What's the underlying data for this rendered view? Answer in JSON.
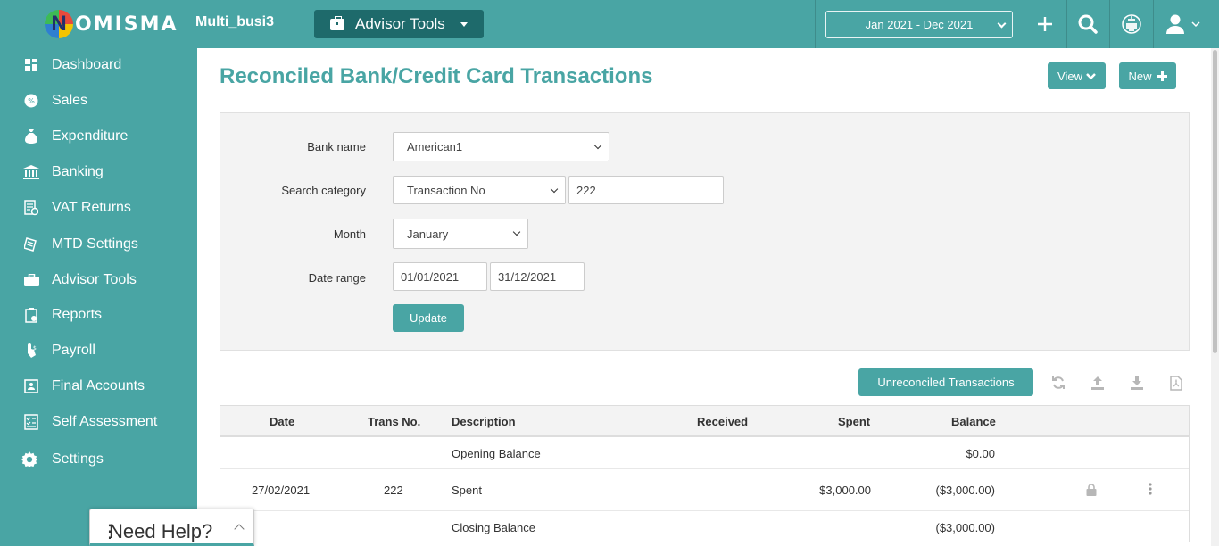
{
  "app": {
    "logo_letter": "N",
    "logo_text": "OMISMA",
    "company": "Multi_busi3",
    "advisor_tools_label": "Advisor Tools",
    "period": "Jan 2021 - Dec 2021"
  },
  "sidebar": {
    "items": [
      {
        "label": "Dashboard",
        "icon": "dashboard-icon"
      },
      {
        "label": "Sales",
        "icon": "sales-icon"
      },
      {
        "label": "Expenditure",
        "icon": "money-bag-icon"
      },
      {
        "label": "Banking",
        "icon": "bank-icon"
      },
      {
        "label": "VAT Returns",
        "icon": "vat-icon"
      },
      {
        "label": "MTD Settings",
        "icon": "mtd-icon"
      },
      {
        "label": "Advisor Tools",
        "icon": "briefcase-icon"
      },
      {
        "label": "Reports",
        "icon": "reports-icon"
      },
      {
        "label": "Payroll",
        "icon": "payroll-icon"
      },
      {
        "label": "Final Accounts",
        "icon": "final-accounts-icon"
      },
      {
        "label": "Self Assessment",
        "icon": "self-assessment-icon"
      },
      {
        "label": "Settings",
        "icon": "gear-icon"
      }
    ]
  },
  "page": {
    "title": "Reconciled Bank/Credit Card Transactions",
    "view_label": "View",
    "new_label": "New"
  },
  "filters": {
    "bank_name_label": "Bank name",
    "bank_name_value": "American1",
    "search_category_label": "Search category",
    "search_category_value": "Transaction No",
    "search_value": "222",
    "month_label": "Month",
    "month_value": "January",
    "date_range_label": "Date range",
    "date_from": "01/01/2021",
    "date_to": "31/12/2021",
    "update_label": "Update"
  },
  "toolbar": {
    "unreconciled_label": "Unreconciled Transactions"
  },
  "table": {
    "headers": {
      "date": "Date",
      "trans_no": "Trans No.",
      "description": "Description",
      "received": "Received",
      "spent": "Spent",
      "balance": "Balance"
    },
    "opening": {
      "description": "Opening Balance",
      "balance": "$0.00"
    },
    "rows": [
      {
        "date": "27/02/2021",
        "trans_no": "222",
        "description": "Spent",
        "received": "",
        "spent": "$3,000.00",
        "balance": "($3,000.00)"
      }
    ],
    "closing": {
      "description": "Closing Balance",
      "balance": "($3,000.00)"
    }
  },
  "help": {
    "label": "Need Help?"
  },
  "colors": {
    "accent": "#49a5a4",
    "dark_accent": "#1e6a6b"
  }
}
